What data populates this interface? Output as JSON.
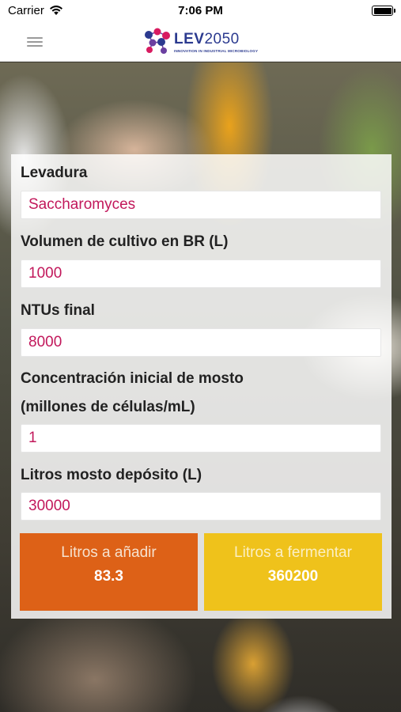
{
  "status_bar": {
    "carrier": "Carrier",
    "time": "7:06 PM"
  },
  "header": {
    "logo_text": "LEV",
    "logo_number": "2050",
    "logo_tagline": "INNOVATION IN INDUSTRIAL MICROBIOLOGY",
    "colors": {
      "logo_blue": "#2b3a8f",
      "logo_red": "#d81b60",
      "logo_purple": "#6a3fa0"
    }
  },
  "form": {
    "levadura": {
      "label": "Levadura",
      "value": "Saccharomyces"
    },
    "volumen": {
      "label": "Volumen de cultivo en BR (L)",
      "value": "1000"
    },
    "ntus": {
      "label": "NTUs final",
      "value": "8000"
    },
    "concentracion": {
      "label_line1": "Concentración inicial de mosto",
      "label_line2": "(millones de células/mL)",
      "value": "1"
    },
    "litros_deposito": {
      "label": "Litros mosto depósito (L)",
      "value": "30000"
    }
  },
  "results": {
    "anadir": {
      "label": "Litros a añadir",
      "value": "83.3",
      "color": "#dd6117"
    },
    "fermentar": {
      "label": "Litros a fermentar",
      "value": "360200",
      "color": "#efc21b"
    }
  },
  "icons": {
    "menu": "hamburger-icon",
    "wifi": "wifi-icon",
    "battery": "battery-icon"
  }
}
